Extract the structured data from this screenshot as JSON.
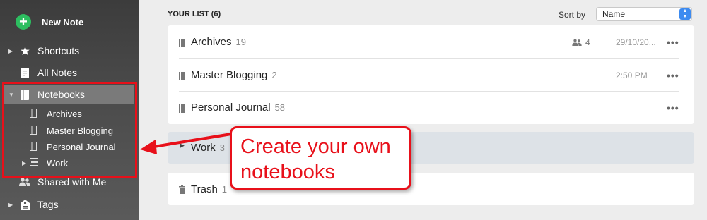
{
  "sidebar": {
    "new_note": "New Note",
    "shortcuts": "Shortcuts",
    "all_notes": "All Notes",
    "notebooks": "Notebooks",
    "sub_notebooks": [
      "Archives",
      "Master Blogging",
      "Personal Journal",
      "Work"
    ],
    "shared_with_me": "Shared with Me",
    "tags": "Tags"
  },
  "list": {
    "header": "YOUR LIST (6)",
    "sort_label": "Sort by",
    "sort_value": "Name",
    "rows": [
      {
        "name": "Archives",
        "count": "19",
        "shared": "4",
        "date": "29/10/20...",
        "more": "•••"
      },
      {
        "name": "Master Blogging",
        "count": "2",
        "shared": "",
        "date": "2:50 PM",
        "more": "•••"
      },
      {
        "name": "Personal Journal",
        "count": "58",
        "shared": "",
        "date": "",
        "more": "•••"
      }
    ],
    "work": {
      "name": "Work",
      "count": "3"
    },
    "trash": {
      "name": "Trash",
      "count": "1"
    }
  },
  "callout": {
    "line1": "Create your own",
    "line2": "notebooks"
  },
  "colors": {
    "accent_red": "#e8101a",
    "new_note_green": "#2dbe60",
    "select_blue": "#3d8bf0"
  }
}
